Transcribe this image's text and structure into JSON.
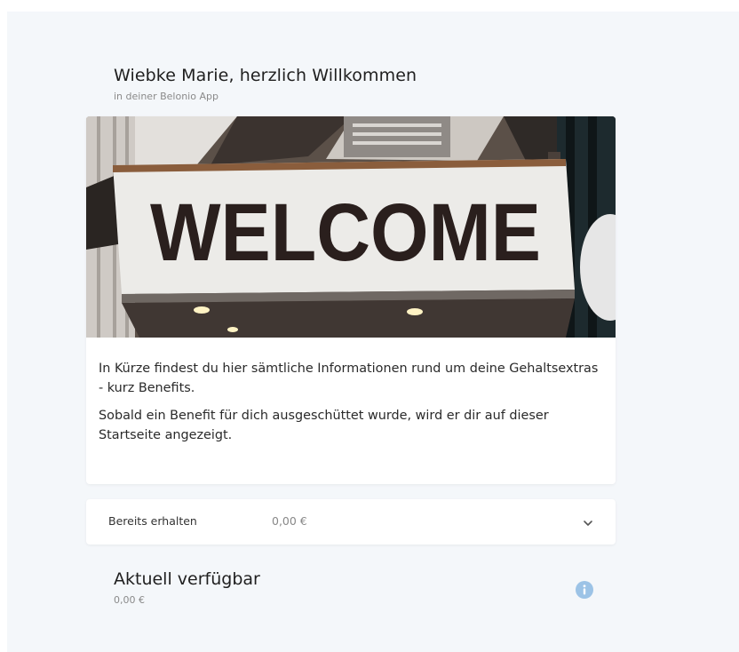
{
  "header": {
    "greeting": "Wiebke Marie, herzlich Willkommen",
    "subtitle": "in deiner Belonio App"
  },
  "welcome_card": {
    "image_text": "WELCOME",
    "paragraphs": [
      "In Kürze findest du hier sämtliche Informationen rund um deine Gehaltsextras - kurz Benefits.",
      "Sobald ein Benefit für dich ausgeschüttet wurde, wird er dir auf dieser Startseite angezeigt."
    ]
  },
  "received": {
    "label": "Bereits erhalten",
    "amount": "0,00 €",
    "icon": "chevron-down-icon"
  },
  "available": {
    "title": "Aktuell verfügbar",
    "amount": "0,00 €",
    "icon": "info-icon"
  },
  "colors": {
    "page_background": "#f4f7fa",
    "card_background": "#ffffff",
    "info_icon": "#9cc3e6",
    "title_text": "#1f1f1f",
    "muted_text": "#8a8a8a"
  }
}
